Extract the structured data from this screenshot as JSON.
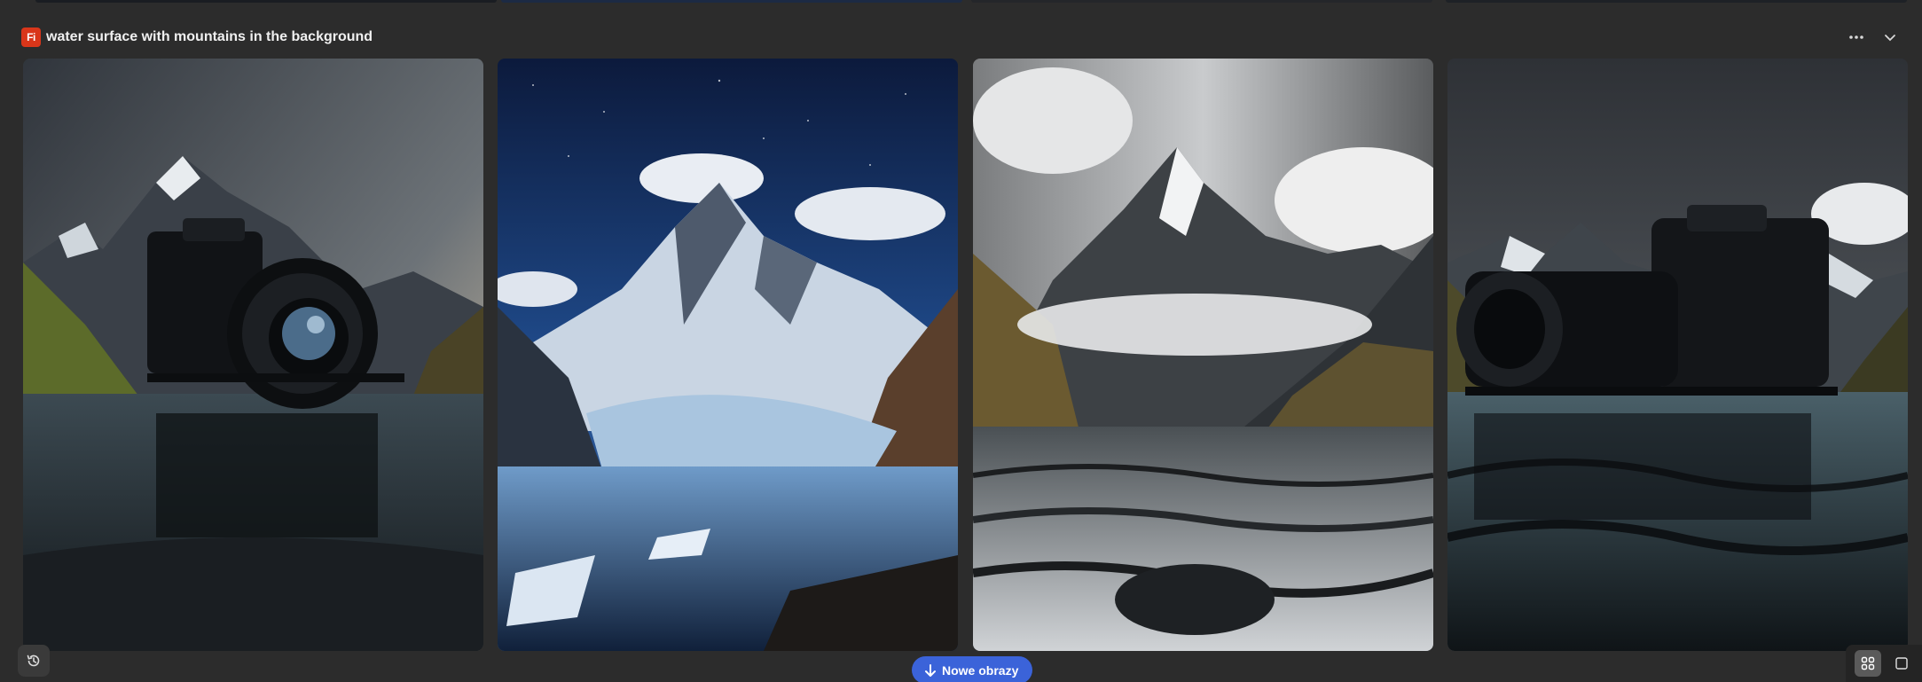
{
  "header": {
    "badge_text": "Fi",
    "prompt": "water surface with mountains in the background",
    "more_icon": "more-horizontal-icon",
    "collapse_icon": "chevron-down-icon"
  },
  "images": [
    {
      "subject": "camera-on-mountain-lake"
    },
    {
      "subject": "glacier-under-starry-sky"
    },
    {
      "subject": "monochrome-peak-over-water"
    },
    {
      "subject": "camera-floating-on-lake"
    }
  ],
  "footer": {
    "history_icon": "history-icon",
    "new_images_label": "Nowe obrazy",
    "new_images_icon": "arrow-down-icon",
    "grid_view_icon": "grid-view-icon",
    "single_view_icon": "single-view-icon"
  },
  "colors": {
    "background": "#2c2c2c",
    "badge": "#d9361a",
    "primary_button": "#3b63d9"
  }
}
